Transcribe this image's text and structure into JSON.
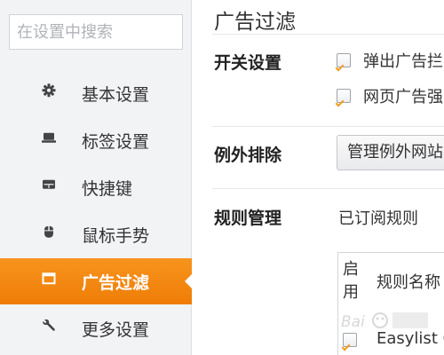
{
  "search": {
    "placeholder": "在设置中搜索"
  },
  "sidebar": {
    "items": [
      {
        "label": "基本设置",
        "icon": "gear-icon"
      },
      {
        "label": "标签设置",
        "icon": "laptop-icon"
      },
      {
        "label": "快捷键",
        "icon": "keyboard-icon"
      },
      {
        "label": "鼠标手势",
        "icon": "mouse-icon"
      },
      {
        "label": "广告过滤",
        "icon": "window-icon",
        "active": true
      },
      {
        "label": "更多设置",
        "icon": "wrench-icon"
      }
    ]
  },
  "main": {
    "title": "广告过滤",
    "switch": {
      "label": "开关设置",
      "options": [
        "弹出广告拦",
        "网页广告强"
      ]
    },
    "exception": {
      "label": "例外排除",
      "button": "管理例外网站"
    },
    "rules": {
      "label": "规则管理",
      "subscribed": "已订阅规则",
      "col_enable": "启用",
      "col_name": "规则名称",
      "rows": [
        {
          "name": "Easylist C"
        }
      ]
    }
  },
  "colors": {
    "accent": "#f08a0f",
    "sidebar_bg": "#f2f3f5"
  }
}
